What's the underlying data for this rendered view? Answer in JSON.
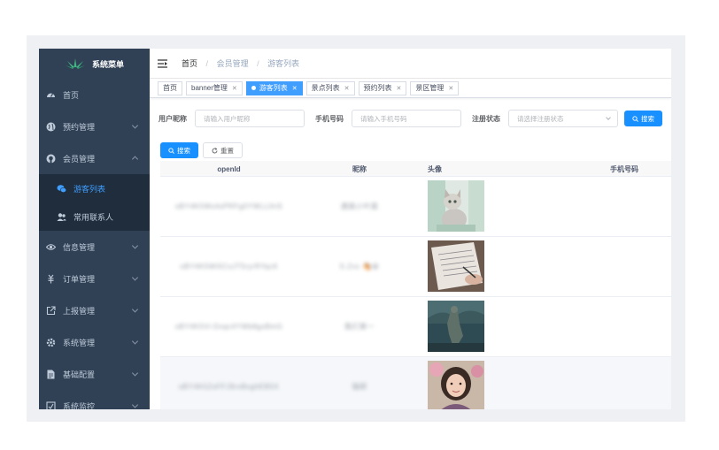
{
  "sidebar": {
    "title": "系统菜单",
    "items": [
      {
        "label": "首页",
        "icon": "dashboard-icon"
      },
      {
        "label": "预约管理",
        "icon": "globe-icon"
      },
      {
        "label": "会员管理",
        "icon": "github-icon",
        "expanded": true,
        "children": [
          {
            "label": "游客列表",
            "icon": "wechat-icon",
            "active": true
          },
          {
            "label": "常用联系人",
            "icon": "peoples-icon"
          }
        ]
      },
      {
        "label": "信息管理",
        "icon": "eye-icon"
      },
      {
        "label": "订单管理",
        "icon": "money-icon"
      },
      {
        "label": "上报管理",
        "icon": "external-link-icon"
      },
      {
        "label": "系统管理",
        "icon": "gear-icon"
      },
      {
        "label": "基础配置",
        "icon": "document-icon"
      },
      {
        "label": "系统监控",
        "icon": "monitor-icon"
      }
    ]
  },
  "breadcrumb": [
    "首页",
    "会员管理",
    "游客列表"
  ],
  "tags": [
    {
      "label": "首页",
      "closable": false
    },
    {
      "label": "banner管理",
      "closable": true
    },
    {
      "label": "游客列表",
      "closable": true,
      "active": true
    },
    {
      "label": "景点列表",
      "closable": true
    },
    {
      "label": "预约列表",
      "closable": true
    },
    {
      "label": "景区管理",
      "closable": true
    }
  ],
  "search": {
    "nickname_label": "用户昵称",
    "nickname_placeholder": "请输入用户昵称",
    "phone_label": "手机号码",
    "phone_placeholder": "请输入手机号码",
    "status_label": "注册状态",
    "status_placeholder": "请选择注册状态",
    "search_button": "搜索"
  },
  "actions": {
    "search": "搜索",
    "reset": "重置"
  },
  "table": {
    "columns": [
      "openId",
      "昵称",
      "头像",
      "手机号码"
    ],
    "rows": [
      {
        "openid": "oBY4K5Ws4sPRFg0YWLL0nS",
        "nickname": "遇路小叶菌",
        "avatar": "cat-photo"
      },
      {
        "openid": "oBY4K5Wi5CoJT5ryrRYqc6",
        "nickname": "S.Zxx 🐴😀",
        "avatar": "notebook-photo"
      },
      {
        "openid": "oBY4K5Vi-Dxqc4YWb8gsBmG",
        "nickname": "我们第一",
        "avatar": "statue-photo"
      },
      {
        "openid": "oBY4K5ZoFFJ9rxBxghEB5X",
        "nickname": "瑞研",
        "avatar": "girl-photo"
      }
    ]
  },
  "colors": {
    "sidebar_bg": "#304156",
    "accent": "#409eff",
    "primary_btn": "#1890ff"
  }
}
